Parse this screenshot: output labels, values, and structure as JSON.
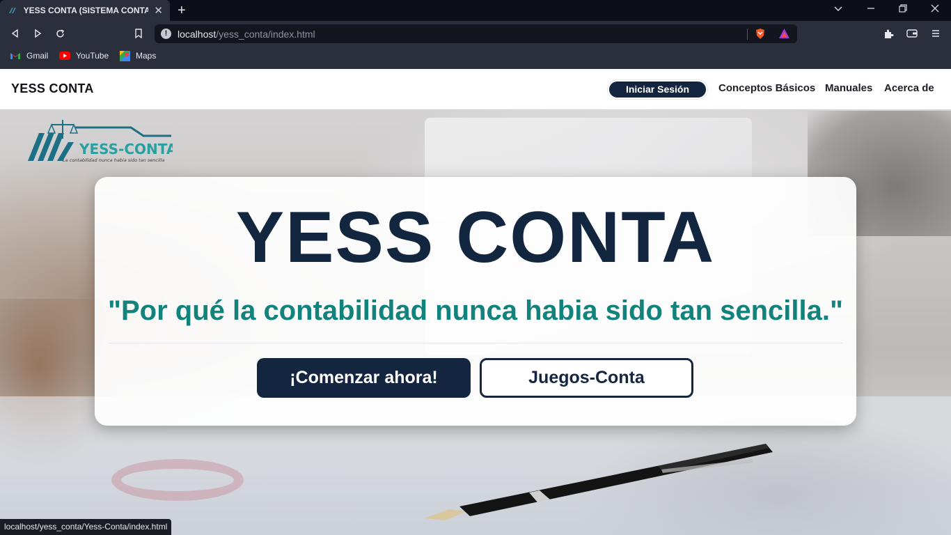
{
  "browser": {
    "tab": {
      "title": "YESS CONTA (SISTEMA CONTABLE",
      "favicon": "yess-conta-favicon"
    },
    "url": {
      "host": "localhost",
      "path": "/yess_conta/index.html"
    },
    "bookmarks": [
      {
        "label": "Gmail",
        "icon": "gmail-icon"
      },
      {
        "label": "YouTube",
        "icon": "youtube-icon"
      },
      {
        "label": "Maps",
        "icon": "maps-icon"
      }
    ],
    "status_url": "localhost/yess_conta/Yess-Conta/index.html"
  },
  "site": {
    "brand": "YESS CONTA",
    "nav": {
      "login": "Iniciar Sesión",
      "links": [
        "Conceptos Básicos",
        "Manuales",
        "Acerca de"
      ]
    },
    "logo": {
      "name": "YESS-CONTA",
      "tagline": "La contabilidad nunca habia sido tan sencilla"
    },
    "hero": {
      "title": "YESS CONTA",
      "subtitle": "\"Por qué la contabilidad nunca habia sido tan sencilla.\"",
      "primary_button": "¡Comenzar ahora!",
      "secondary_button": "Juegos-Conta"
    }
  },
  "colors": {
    "navy": "#14263f",
    "teal": "#12827c",
    "chrome_dark": "#2b2e3b"
  }
}
